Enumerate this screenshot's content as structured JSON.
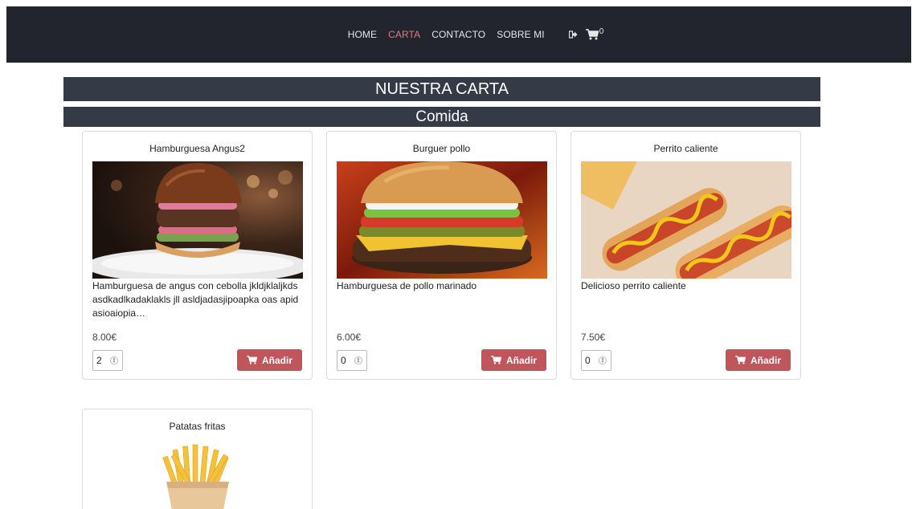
{
  "nav": {
    "links": [
      {
        "label": "HOME",
        "active": false
      },
      {
        "label": "CARTA",
        "active": true
      },
      {
        "label": "CONTACTO",
        "active": false
      },
      {
        "label": "SOBRE MI",
        "active": false
      }
    ],
    "cart_count": "0",
    "icons": [
      "sign-out-icon",
      "cart-icon"
    ]
  },
  "page": {
    "title": "NUESTRA CARTA",
    "section": "Comida"
  },
  "colors": {
    "navbar": "#22252d",
    "banner": "#353a47",
    "accent": "#c1555c",
    "active_link": "#e07b80"
  },
  "products": [
    {
      "name": "Hamburguesa Angus2",
      "description": "Hamburguesa de angus con cebolla jkldjklaljkds asdkadlkadaklakls jll asldjadasjipoapka oas apid asioaiopia…",
      "price": "8.00€",
      "quantity": "2",
      "button": "Añadir"
    },
    {
      "name": "Burguer pollo",
      "description": "Hamburguesa de pollo marinado",
      "price": "6.00€",
      "quantity": "0",
      "button": "Añadir"
    },
    {
      "name": "Perrito caliente",
      "description": "Delicioso perrito caliente",
      "price": "7.50€",
      "quantity": "0",
      "button": "Añadir"
    },
    {
      "name": "Patatas fritas"
    }
  ]
}
